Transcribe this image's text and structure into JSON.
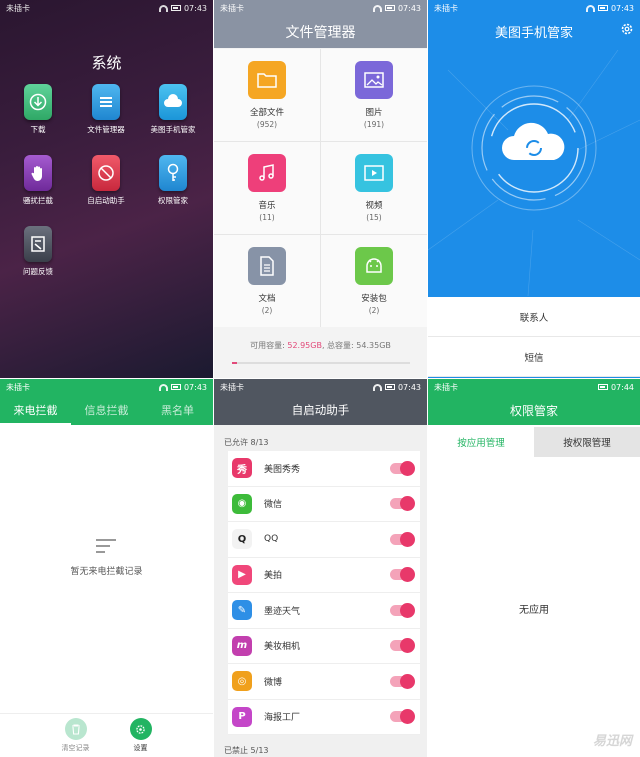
{
  "system_screen": {
    "status": {
      "carrier": "未插卡",
      "time": "07:43"
    },
    "title": "系统",
    "apps": [
      {
        "label": "下载",
        "icon": "download-icon",
        "color": "#3fbf7f"
      },
      {
        "label": "文件管理器",
        "icon": "file-manager-icon",
        "color": "#2f9be0"
      },
      {
        "label": "美图手机管家",
        "icon": "phone-manager-icon",
        "color": "#29a6e3"
      },
      {
        "label": "骚扰拦截",
        "icon": "hand-icon",
        "color": "#8a3fb8"
      },
      {
        "label": "自启动助手",
        "icon": "autostart-icon",
        "color": "#e0384f"
      },
      {
        "label": "权限管家",
        "icon": "key-icon",
        "color": "#2f9be0"
      },
      {
        "label": "问题反馈",
        "icon": "feedback-icon",
        "color": "#555a66"
      }
    ]
  },
  "file_manager": {
    "status": {
      "carrier": "未插卡",
      "time": "07:43"
    },
    "title": "文件管理器",
    "categories": [
      {
        "name": "全部文件",
        "count": "(952)",
        "icon": "folder-icon",
        "color": "#f5a623"
      },
      {
        "name": "图片",
        "count": "(191)",
        "icon": "image-icon",
        "color": "#7b68d9"
      },
      {
        "name": "音乐",
        "count": "(11)",
        "icon": "music-icon",
        "color": "#ee3f7a"
      },
      {
        "name": "视频",
        "count": "(15)",
        "icon": "video-icon",
        "color": "#36c3e0"
      },
      {
        "name": "文档",
        "count": "(2)",
        "icon": "document-icon",
        "color": "#8793a7"
      },
      {
        "name": "安装包",
        "count": "(2)",
        "icon": "android-icon",
        "color": "#6cc84a"
      }
    ],
    "storage": {
      "available_label": "可用容量:",
      "available": "52.95GB",
      "sep": ",",
      "total_label": "总容量:",
      "total": "54.35GB",
      "used_fraction": 0.026
    }
  },
  "phone_manager": {
    "status": {
      "carrier": "未插卡",
      "time": "07:43"
    },
    "title": "美图手机管家",
    "menu": [
      "联系人",
      "短信"
    ],
    "accent": "#1d8de8"
  },
  "call_block": {
    "status": {
      "carrier": "未插卡",
      "time": "07:43"
    },
    "tabs": [
      "来电拦截",
      "信息拦截",
      "黑名单"
    ],
    "empty_text": "暂无来电拦截记录",
    "buttons": [
      {
        "label": "清空记录",
        "icon": "trash-icon",
        "color": "#b9e6cf"
      },
      {
        "label": "设置",
        "icon": "settings-icon",
        "color": "#22b462"
      }
    ]
  },
  "autostart": {
    "status": {
      "carrier": "未插卡",
      "time": "07:43"
    },
    "title": "自启动助手",
    "allowed_label": "已允许 8/13",
    "disabled_label": "已禁止 5/13",
    "apps": [
      {
        "name": "美图秀秀",
        "icon": "meitu-xiuxiu-icon",
        "color": "#e8386a",
        "glyph": "秀",
        "on": true
      },
      {
        "name": "微信",
        "icon": "wechat-icon",
        "color": "#3dbb3a",
        "glyph": "◉",
        "on": true
      },
      {
        "name": "QQ",
        "icon": "qq-icon",
        "color": "#f2f2f2",
        "glyph": "Q",
        "on": true
      },
      {
        "name": "美拍",
        "icon": "meipai-icon",
        "color": "#f0477a",
        "glyph": "▶",
        "on": true
      },
      {
        "name": "墨迹天气",
        "icon": "weather-icon",
        "color": "#2e8fe6",
        "glyph": "✎",
        "on": true
      },
      {
        "name": "美妆相机",
        "icon": "beauty-camera-icon",
        "color": "#c23fae",
        "glyph": "m",
        "on": true
      },
      {
        "name": "微博",
        "icon": "weibo-icon",
        "color": "#f0a01c",
        "glyph": "◎",
        "on": true
      },
      {
        "name": "海报工厂",
        "icon": "poster-factory-icon",
        "color": "#c446c8",
        "glyph": "P",
        "on": true
      }
    ]
  },
  "permissions": {
    "status": {
      "carrier": "未插卡",
      "time": "07:44"
    },
    "title": "权限管家",
    "tabs": [
      "按应用管理",
      "按权限管理"
    ],
    "empty_text": "无应用"
  },
  "watermark": "易迅网"
}
